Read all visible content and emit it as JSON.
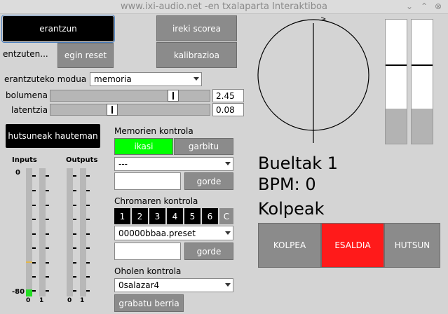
{
  "window": {
    "title": "www.ixi-audio.net -en txalaparta Interaktiboa",
    "minimize": "⌄",
    "maximize": "⌃",
    "close": "⊗"
  },
  "left": {
    "erantzun": "erantzun",
    "entzuten": "entzuten...",
    "egin_reset": "egin reset",
    "mode_label": "erantzuteko modua",
    "mode_value": "memoria",
    "volume_label": "bolumena",
    "volume_value": "2.45",
    "volume_fraction": 0.79,
    "latency_label": "latentzia",
    "latency_value": "0.08",
    "latency_fraction": 0.38,
    "detect_button": "hutsuneak hauteman",
    "inputs_label": "Inputs",
    "outputs_label": "Outputs",
    "scale_top": "0",
    "scale_bottom": "-80",
    "input_channels": [
      "0",
      "1"
    ],
    "output_channels": [
      "0",
      "1"
    ]
  },
  "middle": {
    "ireki_scorea": "ireki scorea",
    "kalibrazioa": "kalibrazioa",
    "memory_title": "Memorien kontrola",
    "ikasi": "ikasi",
    "garbitu": "garbitu",
    "memory_select": "---",
    "gorde1": "gorde",
    "chroma_title": "Chromaren kontrola",
    "chroma_buttons": [
      "1",
      "2",
      "3",
      "4",
      "5",
      "6",
      "C"
    ],
    "preset_select": "00000bbaa.preset",
    "gorde2": "gorde",
    "plank_title": "Oholen kontrola",
    "plank_select": "0salazar4",
    "record_button": "grabatu berria"
  },
  "right": {
    "dial_marker": ">",
    "bueltak": "Bueltak 1",
    "bpm": "BPM: 0",
    "kolpeak": "Kolpeak",
    "kolpea": "KOLPEA",
    "esaldia": "ESALDIA",
    "hutsun": "HUTSUN"
  },
  "colors": {
    "ikasi_active": "#00ff00",
    "esaldia_active": "#ff1a1a",
    "input_indicator": "#e6b84a",
    "input_level": "#22dd22"
  }
}
